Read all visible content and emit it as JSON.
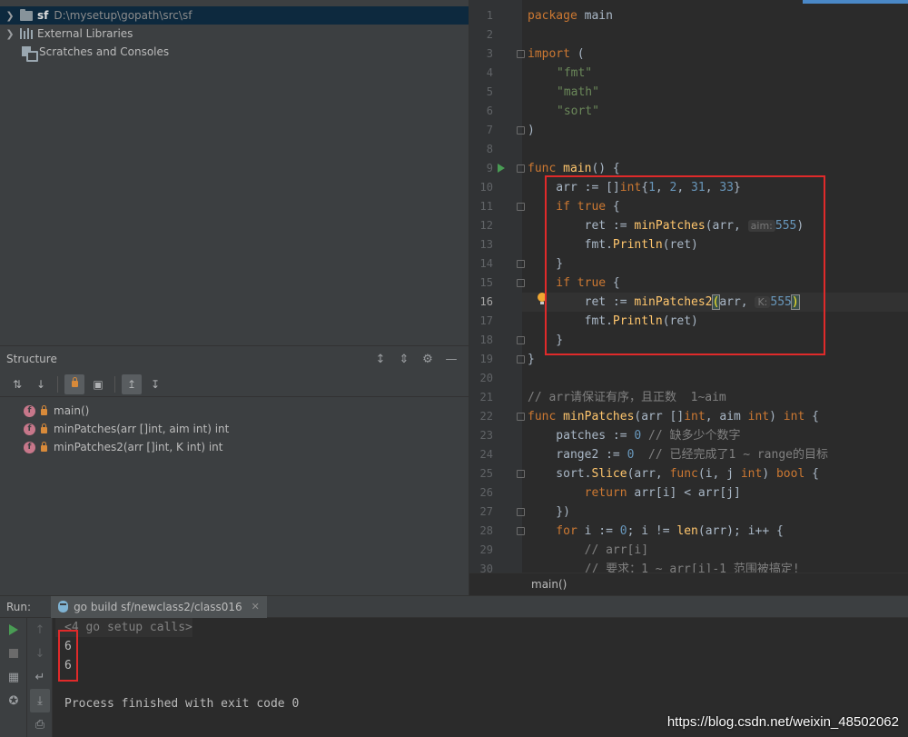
{
  "project": {
    "root": {
      "name": "sf",
      "path": "D:\\mysetup\\gopath\\src\\sf"
    },
    "external_libraries": "External Libraries",
    "scratches": "Scratches and Consoles"
  },
  "structure": {
    "title": "Structure",
    "members": [
      {
        "icon": "f",
        "label": "main()"
      },
      {
        "icon": "f",
        "label": "minPatches(arr []int, aim int) int"
      },
      {
        "icon": "f",
        "label": "minPatches2(arr []int, K int) int"
      }
    ]
  },
  "editor": {
    "line_numbers": [
      "1",
      "2",
      "3",
      "4",
      "5",
      "6",
      "7",
      "8",
      "9",
      "10",
      "11",
      "12",
      "13",
      "14",
      "15",
      "16",
      "17",
      "18",
      "19",
      "20",
      "21",
      "22",
      "23",
      "24",
      "25",
      "26",
      "27",
      "28",
      "29",
      "30"
    ],
    "current_line": 16,
    "hints": {
      "aim": "aim:",
      "k": "K:"
    },
    "code": {
      "l1_kw": "package",
      "l1_rest": " main",
      "l3_kw": "import",
      "l3_rest": " (",
      "l4": "\"fmt\"",
      "l5": "\"math\"",
      "l6": "\"sort\"",
      "l7": ")",
      "l9_kw": "func",
      "l9_fn": " main",
      "l9_rest": "() {",
      "l10_a": "    arr := []",
      "l10_kw": "int",
      "l10_b": "{",
      "l10_n1": "1",
      "l10_c1": ", ",
      "l10_n2": "2",
      "l10_c2": ", ",
      "l10_n3": "31",
      "l10_c3": ", ",
      "l10_n4": "33",
      "l10_d": "}",
      "l11_kw": "    if true",
      "l11_rest": " {",
      "l12_a": "        ret := ",
      "l12_fn": "minPatches",
      "l12_b": "(arr, ",
      "l12_num": "555",
      "l12_c": ")",
      "l13_a": "        fmt.",
      "l13_fn": "Println",
      "l13_b": "(ret)",
      "l14": "    }",
      "l15_kw": "    if true",
      "l15_rest": " {",
      "l16_a": "        ret := ",
      "l16_fn": "minPatches2",
      "l16_open": "(",
      "l16_b": "arr, ",
      "l16_num": "555",
      "l16_close": ")",
      "l17_a": "        fmt.",
      "l17_fn": "Println",
      "l17_b": "(ret)",
      "l18": "    }",
      "l19": "}",
      "l21": "// arr请保证有序，且正数  1~aim",
      "l22_kw": "func",
      "l22_fn": " minPatches",
      "l22_a": "(arr []",
      "l22_t1": "int",
      "l22_b": ", aim ",
      "l22_t2": "int",
      "l22_c": ") ",
      "l22_t3": "int",
      "l22_d": " {",
      "l23_a": "    patches := ",
      "l23_num": "0",
      "l23_cm": " // 缺多少个数字",
      "l24_a": "    range2 := ",
      "l24_num": "0",
      "l24_cm": "  // 已经完成了1 ~ range的目标",
      "l25_a": "    sort.",
      "l25_fn": "Slice",
      "l25_b": "(arr, ",
      "l25_kw": "func",
      "l25_c": "(i, j ",
      "l25_t1": "int",
      "l25_d": ") ",
      "l25_t2": "bool",
      "l25_e": " {",
      "l26_kw": "        return",
      "l26_rest": " arr[i] < arr[j]",
      "l27": "    })",
      "l28_kw": "    for",
      "l28_a": " i := ",
      "l28_n": "0",
      "l28_b": "; i != ",
      "l28_fn": "len",
      "l28_c": "(arr); i++ {",
      "l29": "        // arr[i]",
      "l30": "        // 要求：1 ~ arr[i]-1 范围被搞定!"
    },
    "breadcrumb": "main()"
  },
  "run": {
    "label": "Run:",
    "tab": "go build sf/newclass2/class016",
    "console": {
      "setup": "<4 go setup calls>",
      "out1": "6",
      "out2": "6",
      "exit": "Process finished with exit code 0"
    }
  },
  "watermark": "https://blog.csdn.net/weixin_48502062",
  "colors": {
    "highlight_box": "#e02a2a",
    "keyword": "#cc7832",
    "string": "#6a8759",
    "number": "#6897bb",
    "function": "#ffc66d"
  }
}
